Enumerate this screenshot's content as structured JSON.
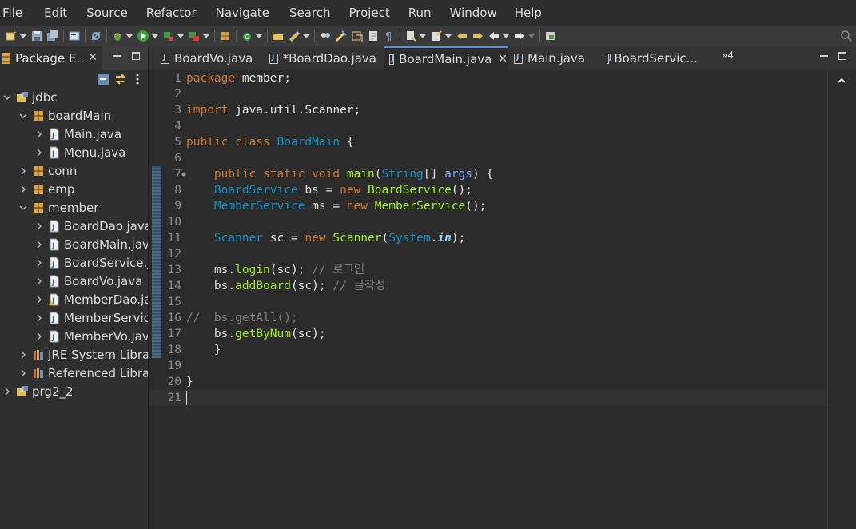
{
  "menu": [
    "File",
    "Edit",
    "Source",
    "Refactor",
    "Navigate",
    "Search",
    "Project",
    "Run",
    "Window",
    "Help"
  ],
  "explorer": {
    "title": "Package E...",
    "close": "✕",
    "tree": [
      {
        "label": "jdbc",
        "depth": 0,
        "icon": "project-icon",
        "expanded": true
      },
      {
        "label": "boardMain",
        "depth": 1,
        "icon": "package-icon",
        "expanded": true
      },
      {
        "label": "Main.java",
        "depth": 2,
        "icon": "java-file-icon",
        "expanded": false
      },
      {
        "label": "Menu.java",
        "depth": 2,
        "icon": "java-file-icon",
        "expanded": false
      },
      {
        "label": "conn",
        "depth": 1,
        "icon": "package-icon",
        "expanded": false
      },
      {
        "label": "emp",
        "depth": 1,
        "icon": "package-icon",
        "expanded": false
      },
      {
        "label": "member",
        "depth": 1,
        "icon": "package-warning-icon",
        "expanded": true
      },
      {
        "label": "BoardDao.java",
        "depth": 2,
        "icon": "java-file-icon",
        "expanded": false
      },
      {
        "label": "BoardMain.java",
        "depth": 2,
        "icon": "java-file-icon",
        "expanded": false
      },
      {
        "label": "BoardService.java",
        "depth": 2,
        "icon": "java-file-icon",
        "expanded": false
      },
      {
        "label": "BoardVo.java",
        "depth": 2,
        "icon": "java-file-icon",
        "expanded": false
      },
      {
        "label": "MemberDao.java",
        "depth": 2,
        "icon": "java-file-warning-icon",
        "expanded": false
      },
      {
        "label": "MemberService.java",
        "depth": 2,
        "icon": "java-file-icon",
        "expanded": false
      },
      {
        "label": "MemberVo.java",
        "depth": 2,
        "icon": "java-file-icon",
        "expanded": false
      },
      {
        "label": "JRE System Library",
        "depth": 1,
        "icon": "library-icon",
        "expanded": false
      },
      {
        "label": "Referenced Libraries",
        "depth": 1,
        "icon": "library-icon",
        "expanded": false
      },
      {
        "label": "prg2_2",
        "depth": 0,
        "icon": "project-icon",
        "expanded": false
      }
    ]
  },
  "editor": {
    "tabs": [
      {
        "label": "BoardVo.java",
        "active": false,
        "dirty": false
      },
      {
        "label": "*BoardDao.java",
        "active": false,
        "dirty": true
      },
      {
        "label": "BoardMain.java",
        "active": true,
        "dirty": false
      },
      {
        "label": "Main.java",
        "active": false,
        "dirty": false
      },
      {
        "label": "BoardServic...",
        "active": false,
        "dirty": false
      }
    ],
    "more_tabs": "»4",
    "current_line": 21,
    "lines": [
      [
        [
          "kw",
          "package"
        ],
        [
          "pu",
          " member;"
        ]
      ],
      [],
      [
        [
          "kw",
          "import"
        ],
        [
          "pu",
          " java.util.Scanner;"
        ]
      ],
      [],
      [
        [
          "kw",
          "public"
        ],
        [
          "pu",
          " "
        ],
        [
          "kw",
          "class"
        ],
        [
          "pu",
          " "
        ],
        [
          "ty",
          "BoardMain"
        ],
        [
          "pu",
          " {"
        ]
      ],
      [],
      [
        [
          "pu",
          "    "
        ],
        [
          "kw",
          "public"
        ],
        [
          "pu",
          " "
        ],
        [
          "kw",
          "static"
        ],
        [
          "pu",
          " "
        ],
        [
          "kw",
          "void"
        ],
        [
          "pu",
          " "
        ],
        [
          "fn",
          "main"
        ],
        [
          "pu",
          "("
        ],
        [
          "ty",
          "String"
        ],
        [
          "pu",
          "[] "
        ],
        [
          "ar",
          "args"
        ],
        [
          "pu",
          ") {"
        ]
      ],
      [
        [
          "pu",
          "    "
        ],
        [
          "ty",
          "BoardService"
        ],
        [
          "pu",
          " "
        ],
        [
          "vr",
          "bs"
        ],
        [
          "pu",
          " = "
        ],
        [
          "kw",
          "new"
        ],
        [
          "pu",
          " "
        ],
        [
          "fn",
          "BoardService"
        ],
        [
          "pu",
          "();"
        ]
      ],
      [
        [
          "pu",
          "    "
        ],
        [
          "ty",
          "MemberService"
        ],
        [
          "pu",
          " "
        ],
        [
          "vr",
          "ms"
        ],
        [
          "pu",
          " = "
        ],
        [
          "kw",
          "new"
        ],
        [
          "pu",
          " "
        ],
        [
          "fn",
          "MemberService"
        ],
        [
          "pu",
          "();"
        ]
      ],
      [],
      [
        [
          "pu",
          "    "
        ],
        [
          "ty",
          "Scanner"
        ],
        [
          "pu",
          " "
        ],
        [
          "vr",
          "sc"
        ],
        [
          "pu",
          " = "
        ],
        [
          "kw",
          "new"
        ],
        [
          "pu",
          " "
        ],
        [
          "fn",
          "Scanner"
        ],
        [
          "pu",
          "("
        ],
        [
          "ty",
          "System"
        ],
        [
          "pu",
          "."
        ],
        [
          "st",
          "in"
        ],
        [
          "pu",
          ");"
        ]
      ],
      [],
      [
        [
          "pu",
          "    "
        ],
        [
          "vr",
          "ms"
        ],
        [
          "pu",
          "."
        ],
        [
          "fn",
          "login"
        ],
        [
          "pu",
          "("
        ],
        [
          "vr",
          "sc"
        ],
        [
          "pu",
          "); "
        ],
        [
          "cm",
          "// 로그인"
        ]
      ],
      [
        [
          "pu",
          "    "
        ],
        [
          "vr",
          "bs"
        ],
        [
          "pu",
          "."
        ],
        [
          "fn",
          "addBoard"
        ],
        [
          "pu",
          "("
        ],
        [
          "vr",
          "sc"
        ],
        [
          "pu",
          "); "
        ],
        [
          "cm",
          "// 글작성"
        ]
      ],
      [],
      [
        [
          "cm",
          "//  bs.getAll();"
        ]
      ],
      [
        [
          "pu",
          "    "
        ],
        [
          "vr",
          "bs"
        ],
        [
          "pu",
          "."
        ],
        [
          "fn",
          "getByNum"
        ],
        [
          "pu",
          "("
        ],
        [
          "vr",
          "sc"
        ],
        [
          "pu",
          ");"
        ]
      ],
      [
        [
          "pu",
          "    }"
        ]
      ],
      [],
      [
        [
          "pu",
          "}"
        ]
      ],
      []
    ]
  },
  "colors": {
    "keyword": "#cc7832",
    "type": "#1290c3",
    "method": "#a7ec21",
    "comment": "#808080",
    "active_tab_accent": "#5a8fd8"
  }
}
